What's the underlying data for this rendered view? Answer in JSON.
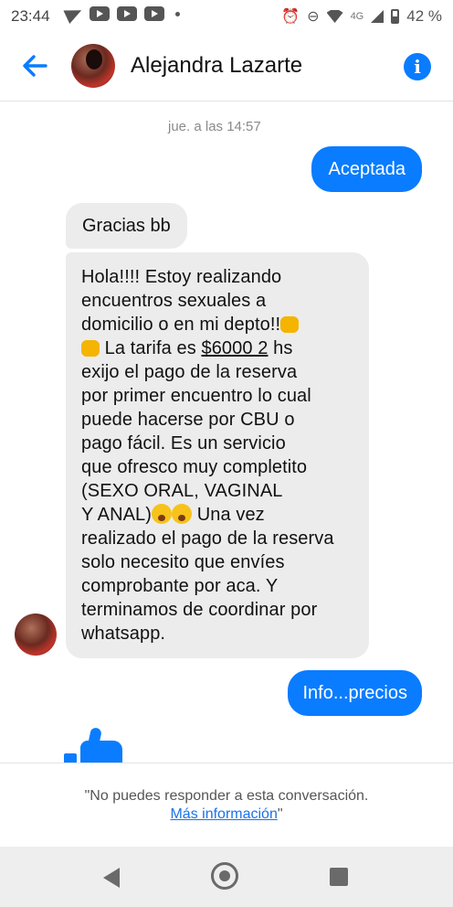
{
  "status_bar": {
    "time": "23:44",
    "network": "4G",
    "battery": "42 %"
  },
  "header": {
    "contact_name": "Alejandra Lazarte",
    "info_icon": "i"
  },
  "conversation": {
    "timestamp": "jue. a las 14:57",
    "messages": [
      {
        "from": "me",
        "text": "Aceptada"
      },
      {
        "from": "contact",
        "text": "Gracias bb"
      },
      {
        "from": "contact",
        "line1": "Hola!!!!  Estoy realizando",
        "line2": "encuentros sexuales a",
        "line3": "domicilio o en mi depto!!",
        "line4_a": " La tarifa  es  ",
        "line4_price": "$6000 2",
        "line4_b": " hs",
        "line5": "exijo el pago de la reserva",
        "line6": "por primer encuentro lo cual",
        "line7": "puede hacerse por CBU o",
        "line8": "pago fácil. Es un servicio",
        "line9": "que ofresco  muy completito",
        "line10": "(SEXO ORAL, VAGINAL",
        "line11_a": "Y ANAL)",
        "line11_b": " Una vez",
        "line12": "realizado el pago de la reserva",
        "line13": "solo necesito que envíes",
        "line14": "comprobante por aca. Y",
        "line15": "terminamos de coordinar por",
        "line16": "whatsapp."
      },
      {
        "from": "me",
        "text": "Info...precios"
      }
    ]
  },
  "footer": {
    "notice": "\"No puedes responder a esta conversación.",
    "link_text": "Más información",
    "link_suffix": "\""
  },
  "colors": {
    "accent": "#0a7cff",
    "incoming_bubble": "#ececec",
    "link": "#1a73e8"
  }
}
